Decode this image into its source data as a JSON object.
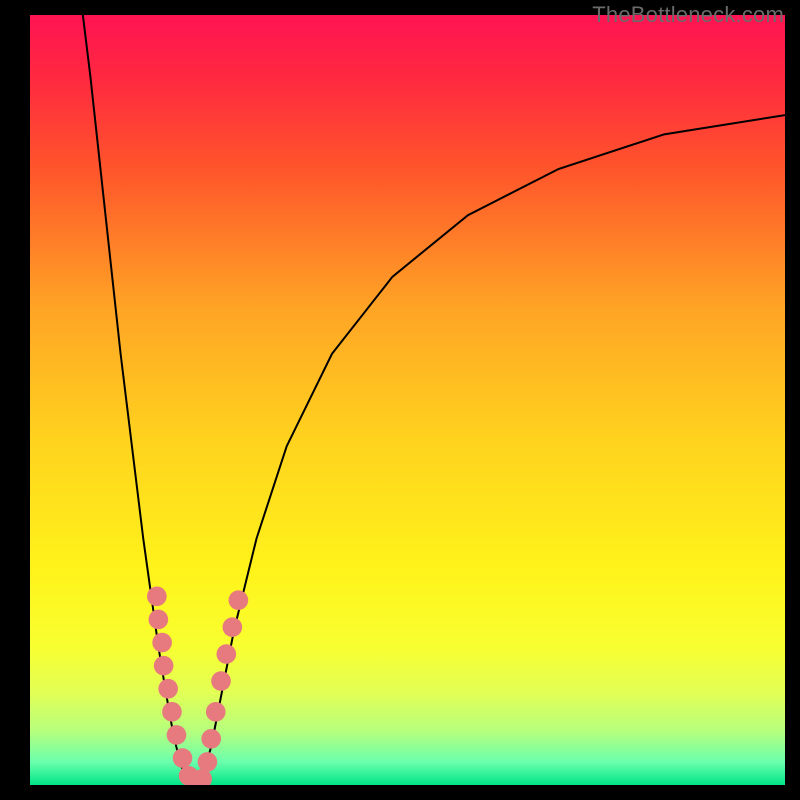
{
  "watermark": {
    "text": "TheBottleneck.com"
  },
  "chart_data": {
    "type": "line",
    "title": "",
    "xlabel": "",
    "ylabel": "",
    "xlim": [
      0,
      100
    ],
    "ylim": [
      0,
      100
    ],
    "grid": false,
    "gradient_stops": [
      {
        "offset": 0.0,
        "color": "#ff1453"
      },
      {
        "offset": 0.08,
        "color": "#ff2840"
      },
      {
        "offset": 0.2,
        "color": "#ff552b"
      },
      {
        "offset": 0.38,
        "color": "#ffa425"
      },
      {
        "offset": 0.55,
        "color": "#ffd21e"
      },
      {
        "offset": 0.72,
        "color": "#fff31a"
      },
      {
        "offset": 0.82,
        "color": "#f8ff30"
      },
      {
        "offset": 0.88,
        "color": "#e2ff55"
      },
      {
        "offset": 0.93,
        "color": "#b6ff7d"
      },
      {
        "offset": 0.97,
        "color": "#6bffac"
      },
      {
        "offset": 1.0,
        "color": "#00e588"
      }
    ],
    "series": [
      {
        "name": "left-branch",
        "stroke": "#000000",
        "points": [
          {
            "x": 7.0,
            "y": 100.0
          },
          {
            "x": 8.0,
            "y": 92.0
          },
          {
            "x": 9.0,
            "y": 83.0
          },
          {
            "x": 10.0,
            "y": 74.0
          },
          {
            "x": 11.0,
            "y": 65.0
          },
          {
            "x": 12.0,
            "y": 56.0
          },
          {
            "x": 13.0,
            "y": 48.0
          },
          {
            "x": 14.0,
            "y": 40.0
          },
          {
            "x": 15.0,
            "y": 32.0
          },
          {
            "x": 16.0,
            "y": 25.0
          },
          {
            "x": 17.0,
            "y": 18.0
          },
          {
            "x": 18.0,
            "y": 12.0
          },
          {
            "x": 19.0,
            "y": 6.5
          },
          {
            "x": 20.0,
            "y": 2.5
          },
          {
            "x": 21.0,
            "y": 0.5
          },
          {
            "x": 22.0,
            "y": 0.0
          }
        ]
      },
      {
        "name": "right-branch",
        "stroke": "#000000",
        "points": [
          {
            "x": 22.0,
            "y": 0.0
          },
          {
            "x": 23.0,
            "y": 1.5
          },
          {
            "x": 24.0,
            "y": 5.0
          },
          {
            "x": 25.0,
            "y": 10.0
          },
          {
            "x": 27.0,
            "y": 20.0
          },
          {
            "x": 30.0,
            "y": 32.0
          },
          {
            "x": 34.0,
            "y": 44.0
          },
          {
            "x": 40.0,
            "y": 56.0
          },
          {
            "x": 48.0,
            "y": 66.0
          },
          {
            "x": 58.0,
            "y": 74.0
          },
          {
            "x": 70.0,
            "y": 80.0
          },
          {
            "x": 84.0,
            "y": 84.5
          },
          {
            "x": 100.0,
            "y": 87.0
          }
        ]
      }
    ],
    "markers": {
      "color": "#e77a7f",
      "radius": 1.3,
      "points_xy": [
        [
          16.8,
          24.5
        ],
        [
          17.0,
          21.5
        ],
        [
          17.5,
          18.5
        ],
        [
          17.7,
          15.5
        ],
        [
          18.3,
          12.5
        ],
        [
          18.8,
          9.5
        ],
        [
          19.4,
          6.5
        ],
        [
          20.2,
          3.5
        ],
        [
          21.0,
          1.2
        ],
        [
          22.0,
          0.3
        ],
        [
          22.8,
          0.8
        ],
        [
          23.5,
          3.0
        ],
        [
          24.0,
          6.0
        ],
        [
          24.6,
          9.5
        ],
        [
          25.3,
          13.5
        ],
        [
          26.0,
          17.0
        ],
        [
          26.8,
          20.5
        ],
        [
          27.6,
          24.0
        ]
      ]
    }
  }
}
